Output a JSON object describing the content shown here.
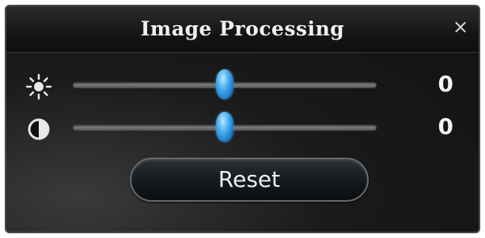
{
  "dialog": {
    "title": "Image Processing",
    "close_glyph": "×"
  },
  "brightness": {
    "icon": "brightness-icon",
    "value": "0",
    "level": 0.5
  },
  "contrast": {
    "icon": "contrast-icon",
    "value": "0",
    "level": 0.5
  },
  "reset_label": "Reset",
  "colors": {
    "accent": "#3aa0ea",
    "background": "#151515",
    "text": "#f2f2f2"
  }
}
